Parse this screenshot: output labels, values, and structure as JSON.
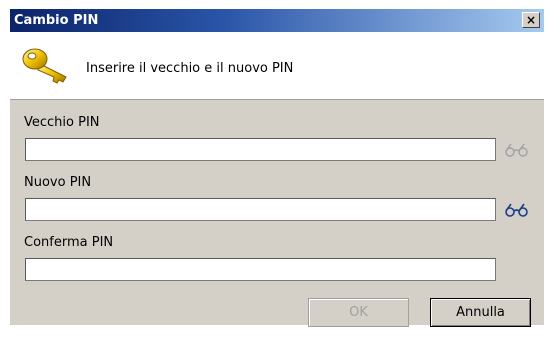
{
  "window": {
    "title": "Cambio PIN",
    "close_label": "×"
  },
  "header": {
    "icon": "key-icon",
    "instruction": "Inserire il vecchio e il nuovo PIN"
  },
  "fields": [
    {
      "label": "Vecchio PIN",
      "value": "",
      "reveal_icon": "glasses-icon",
      "reveal_enabled": false
    },
    {
      "label": "Nuovo PIN",
      "value": "",
      "reveal_icon": "glasses-icon",
      "reveal_enabled": true
    },
    {
      "label": "Conferma PIN",
      "value": ""
    }
  ],
  "buttons": {
    "ok_label": "OK",
    "ok_enabled": false,
    "cancel_label": "Annulla"
  },
  "colors": {
    "titlebar_start": "#0b246a",
    "titlebar_end": "#a6caf0",
    "dialog_bg": "#d4d0c8",
    "icon_active": "#1c3d8c",
    "icon_disabled": "#a0a0a0"
  }
}
